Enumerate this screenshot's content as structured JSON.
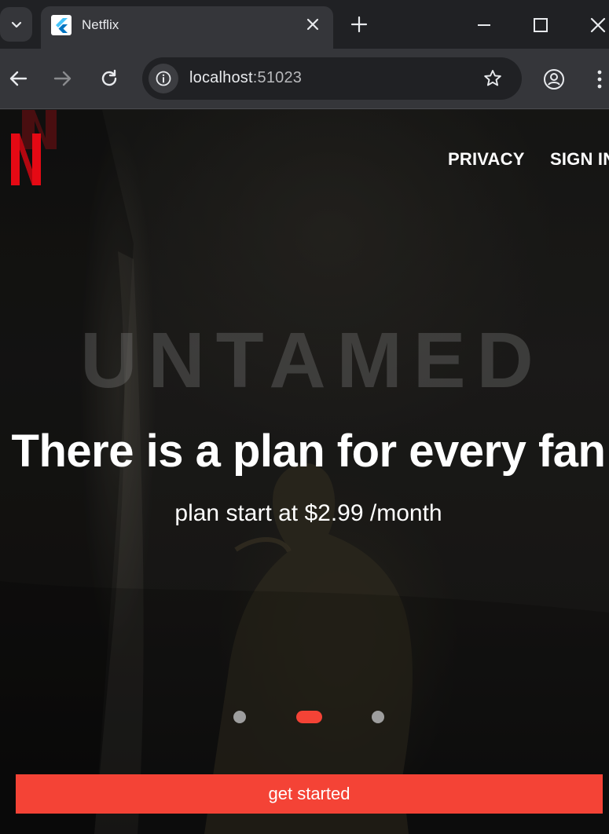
{
  "browser": {
    "tab": {
      "title": "Netflix",
      "favicon": "flutter-icon"
    },
    "url": {
      "host": "localhost",
      "port": ":51023"
    },
    "icons": [
      "tab-search-icon",
      "close-icon",
      "plus-icon",
      "minimize-icon",
      "maximize-icon",
      "close-window-icon",
      "back-icon",
      "forward-icon",
      "reload-icon",
      "site-info-icon",
      "star-icon",
      "profile-icon",
      "more-vertical-icon"
    ]
  },
  "header": {
    "logo": "netflix-logo",
    "nav": [
      {
        "label": "PRIVACY"
      },
      {
        "label": "SIGN IN"
      }
    ]
  },
  "hero": {
    "background_title": "UNTAMED",
    "headline": "There is a plan for every fan",
    "subline": "plan start at $2.99 /month"
  },
  "carousel": {
    "slides": 3,
    "active_index": 1,
    "active_color": "#f44336",
    "inactive_color": "#9e9e9e"
  },
  "cta": {
    "label": "get started",
    "color": "#f44336"
  }
}
